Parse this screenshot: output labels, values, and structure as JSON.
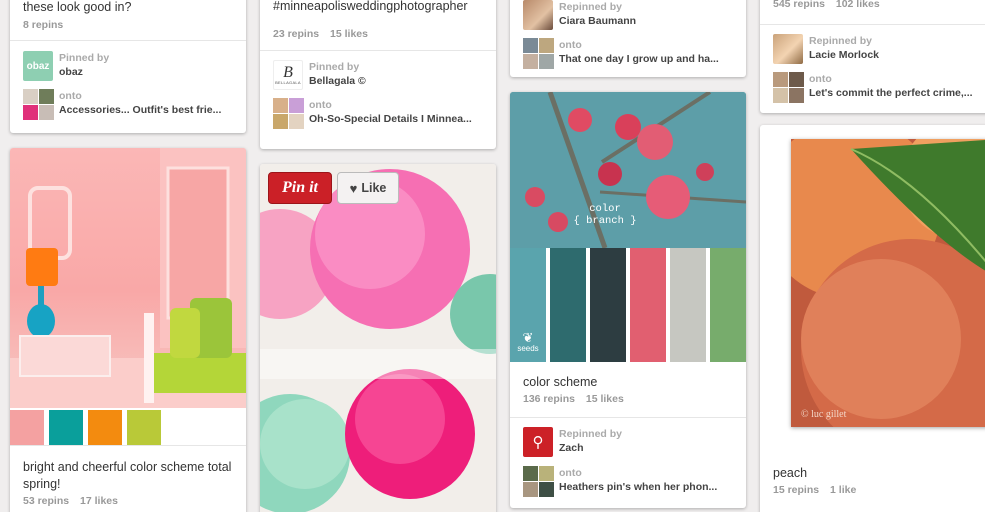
{
  "colors": {
    "pinit_red": "#cb2027",
    "zach_red": "#cc2127",
    "obaz_green": "#8ecfb2",
    "palette_spring": [
      "#f4a1a1",
      "#0a9f9b",
      "#f38b0f",
      "#b9c938",
      "#ffffff"
    ],
    "palette_branch": [
      "#5aa4ad",
      "#2e6b6e",
      "#2d3d41",
      "#e15f70",
      "#c6c7c1",
      "#77ac6c"
    ]
  },
  "col1": {
    "top": {
      "caption": "these look good in?",
      "repins": "8 repins",
      "pinned_by_label": "Pinned by",
      "pinner": "obaz",
      "avatar_text": "obaz",
      "onto_label": "onto",
      "board": "Accessories... Outfit's best frie..."
    },
    "spring": {
      "caption": "bright and cheerful color scheme total spring!",
      "repins": "53 repins",
      "likes": "17 likes"
    }
  },
  "col2": {
    "top": {
      "caption": "#minneapolisweddingphotographer",
      "repins": "23 repins",
      "likes": "15 likes",
      "pinned_by_label": "Pinned by",
      "pinner": "Bellagala ©",
      "avatar_text": "B",
      "avatar_subtext": "BELLAGALA",
      "onto_label": "onto",
      "board": "Oh-So-Special Details I Minnea..."
    },
    "poms": {
      "pinit_label": "Pin it",
      "like_label": "Like"
    }
  },
  "col3": {
    "top": {
      "repinned_by_label": "Repinned by",
      "repinner": "Ciara Baumann",
      "onto_label": "onto",
      "board": "That one day I grow up and ha..."
    },
    "branch": {
      "image_title": "color",
      "image_subtitle": "{ branch }",
      "seeds_label": "seeds",
      "caption": "color scheme",
      "repins": "136 repins",
      "likes": "15 likes",
      "repinned_by_label": "Repinned by",
      "repinner": "Zach",
      "onto_label": "onto",
      "board": "Heathers pin's when her phon..."
    }
  },
  "col4": {
    "top": {
      "repins": "545 repins",
      "likes": "102 likes",
      "repinned_by_label": "Repinned by",
      "repinner": "Lacie Morlock",
      "onto_label": "onto",
      "board": "Let's commit the perfect crime,..."
    },
    "peach": {
      "watermark": "© luc gillet",
      "caption": "peach",
      "repins": "15 repins",
      "likes": "1 like"
    }
  }
}
